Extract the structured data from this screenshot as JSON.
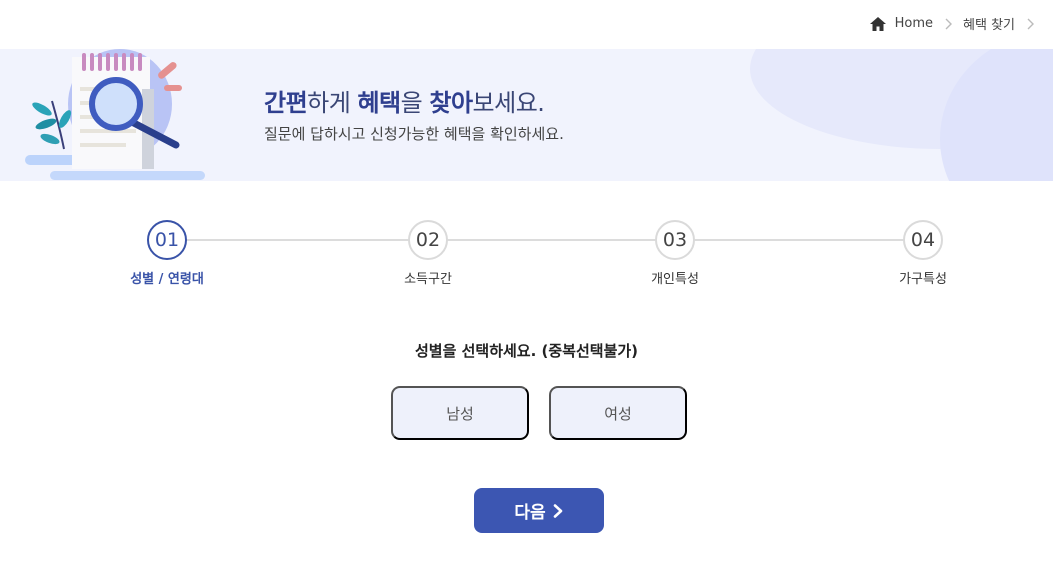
{
  "breadcrumb": {
    "home": "Home",
    "current": "혜택 찾기"
  },
  "banner": {
    "title_parts": {
      "p1": "간편",
      "p2": "하게 ",
      "p3": "혜택",
      "p4": "을 ",
      "p5": "찾아",
      "p6": "보세요."
    },
    "subtitle": "질문에 답하시고 신청가능한 혜택을 확인하세요."
  },
  "steps": [
    {
      "number": "01",
      "label": "성별 / 연령대",
      "active": true
    },
    {
      "number": "02",
      "label": "소득구간",
      "active": false
    },
    {
      "number": "03",
      "label": "개인특성",
      "active": false
    },
    {
      "number": "04",
      "label": "가구특성",
      "active": false
    }
  ],
  "question": "성별을 선택하세요. (중복선택불가)",
  "options": [
    "남성",
    "여성"
  ],
  "next_button": "다음",
  "colors": {
    "accent": "#3c56b2",
    "banner_bg": "#f1f3fd",
    "option_bg": "#eef1fb"
  }
}
